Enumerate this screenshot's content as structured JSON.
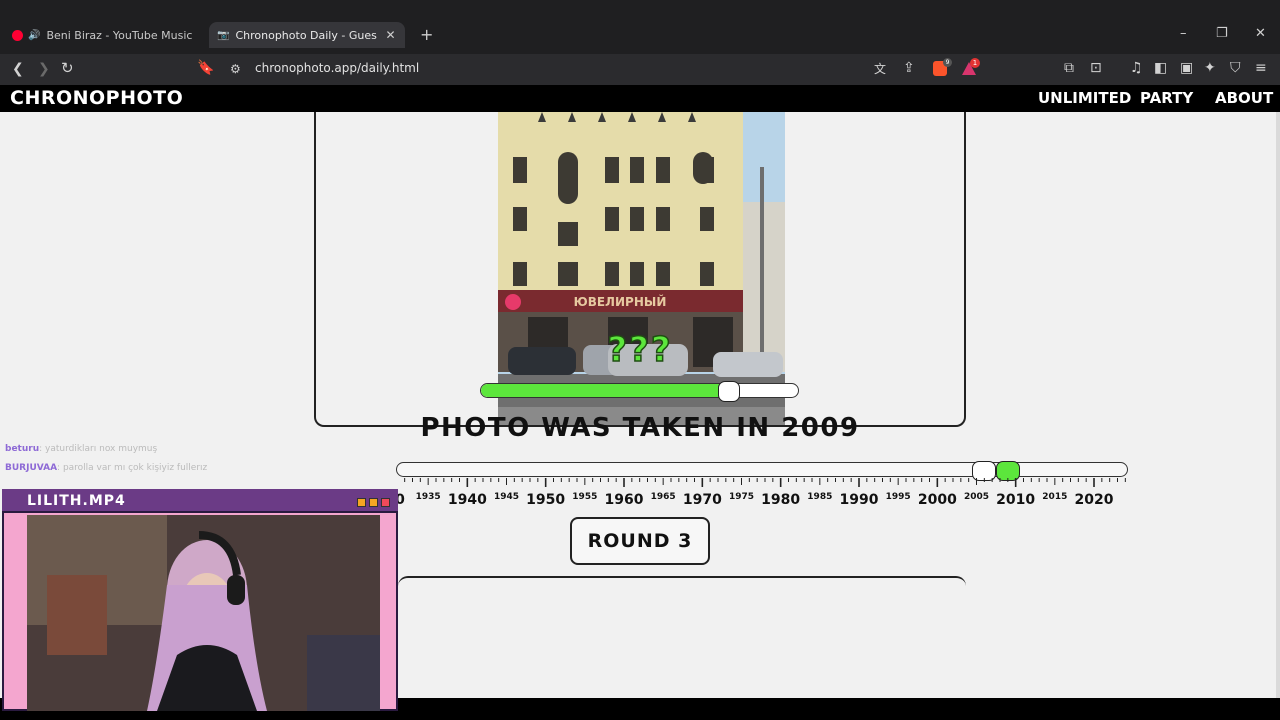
{
  "browser": {
    "tabs": [
      {
        "label": "Beni Biraz - YouTube Music",
        "favicon_color": "#ff0033"
      },
      {
        "label": "Chronophoto Daily - Guess the Y",
        "favicon_color": "#bdbdbd"
      }
    ],
    "new_tab": "+",
    "window_controls": [
      "–",
      "❐",
      "✕"
    ],
    "url": "chronophoto.app/daily.html",
    "brave_shield_badge": "9",
    "rewards_badge": "1"
  },
  "site": {
    "logo": "CHRONOPHOTO",
    "nav": [
      "UNLIMITED",
      "PARTY",
      "ABOUT"
    ]
  },
  "game": {
    "score_display": "???",
    "score_bar_fraction": 0.78,
    "result_text": "PHOTO WAS TAKEN IN 2009",
    "actual_year": 2009,
    "guessed_year": 2006,
    "timeline": {
      "major_labels": [
        "1940",
        "1950",
        "1960",
        "1970",
        "1980",
        "1990",
        "2000",
        "2010",
        "2020"
      ],
      "minor_labels": [
        "1935",
        "1945",
        "1955",
        "1965",
        "1975",
        "1985",
        "1995",
        "2005",
        "2015"
      ],
      "cut_label": "0"
    },
    "round_button": "ROUND 3",
    "photo_sign": "ЮВЕЛИРНЫЙ"
  },
  "chat": [
    {
      "user": "beturu",
      "message": ": yaturdikları nox muymuş"
    },
    {
      "user": "BURJUVAA",
      "message": ": parolla var mı çok kişiyiz fullerız"
    }
  ],
  "webcam": {
    "title": "LILITH.MP4",
    "frame_color": "#f4a6cf",
    "title_color": "#6b3b86"
  },
  "colors": {
    "accent_green": "#5ce63c",
    "page_bg": "#f1f1f1"
  }
}
